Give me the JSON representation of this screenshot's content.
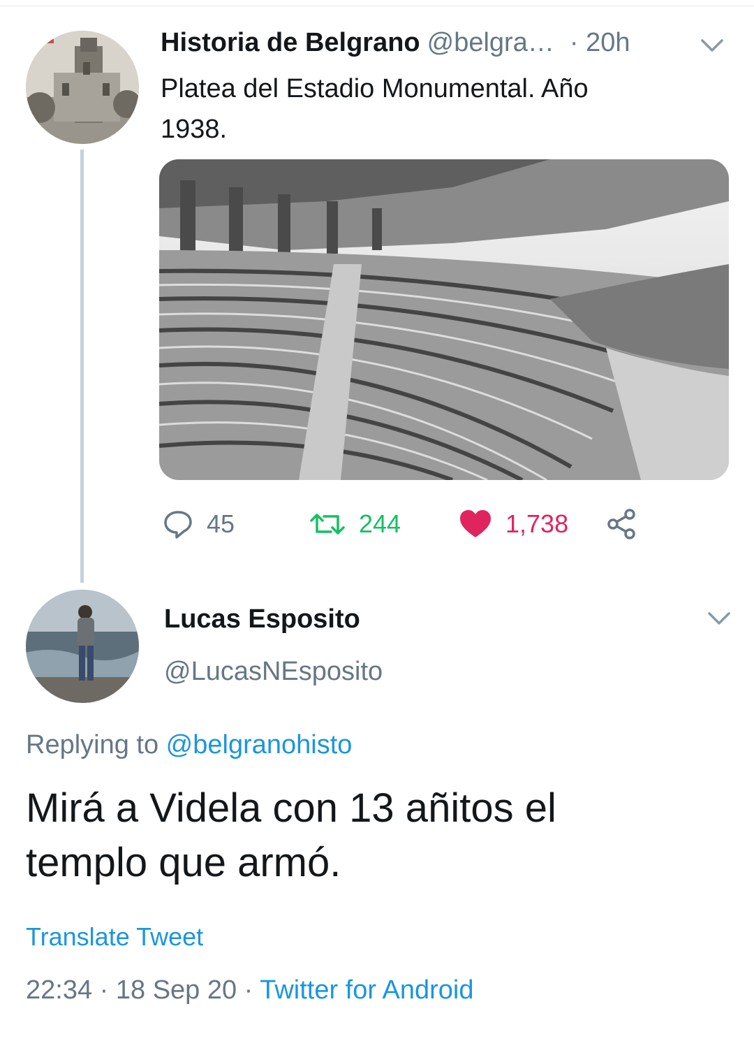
{
  "colors": {
    "text": "#14171a",
    "secondary": "#657786",
    "link": "#1b95e0",
    "retweet": "#17bf63",
    "like": "#e0245e",
    "thread_line": "#c4d1da"
  },
  "tweet": {
    "display_name": "Historia de Belgrano",
    "handle": "@belgra…",
    "time": "· 20h",
    "text_line1": "Platea del Estadio Monumental. Año",
    "text_line2": "1938.",
    "media_description": "black-and-white photo of stadium grandstand seating",
    "avatar_icon": "profile-photo",
    "menu_icon": "chevron-down-icon",
    "stats": {
      "replies": "45",
      "retweets": "244",
      "likes": "1,738"
    },
    "icons": {
      "reply": "reply-icon",
      "retweet": "retweet-icon",
      "like": "heart-icon",
      "share": "share-icon"
    }
  },
  "reply": {
    "display_name": "Lucas Esposito",
    "handle": "@LucasNEsposito",
    "replying_prefix": "Replying to ",
    "replying_to": "@belgranohisto",
    "text_line1": "Mirá a Videla con 13 añitos el",
    "text_line2": "templo que armó.",
    "translate_label": "Translate Tweet",
    "time": "22:34 · 18 Sep 20 · ",
    "source": "Twitter for Android",
    "menu_icon": "chevron-down-icon"
  }
}
